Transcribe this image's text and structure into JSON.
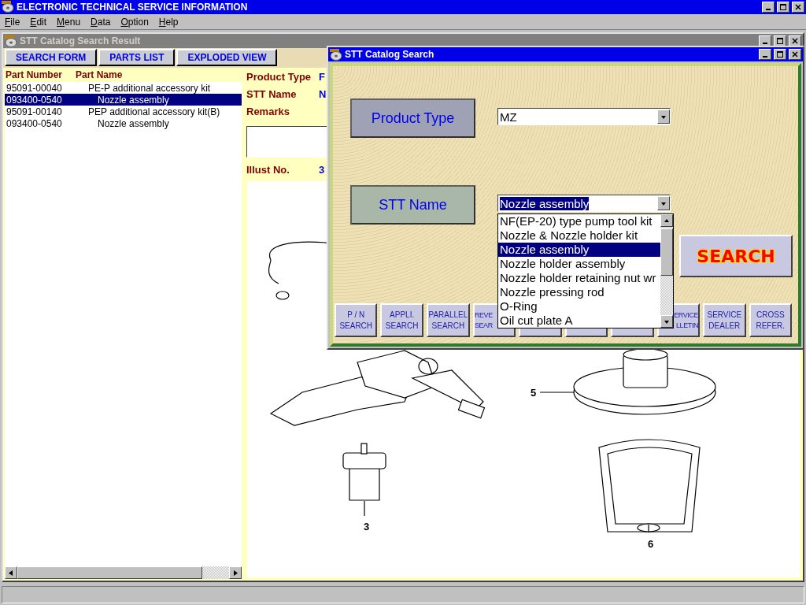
{
  "app": {
    "title": "ELECTRONIC TECHNICAL SERVICE INFORMATION"
  },
  "menu": [
    "File",
    "Edit",
    "Menu",
    "Data",
    "Option",
    "Help"
  ],
  "result_window": {
    "title": "STT Catalog Search Result",
    "toolbar": [
      "SEARCH FORM",
      "PARTS LIST",
      "EXPLODED VIEW"
    ],
    "columns": [
      "Part Number",
      "Part Name"
    ],
    "rows": [
      {
        "part_number": "95091-00040",
        "part_name": "PE-P additional accessory kit",
        "selected": false,
        "children": [
          {
            "part_number": "093400-0540",
            "part_name": "Nozzle assembly",
            "selected": true
          }
        ]
      },
      {
        "part_number": "95091-00140",
        "part_name": "PEP additional accessory kit(B)",
        "selected": false,
        "children": [
          {
            "part_number": "093400-0540",
            "part_name": "Nozzle assembly",
            "selected": false
          }
        ]
      }
    ],
    "info": [
      {
        "label": "Product Type",
        "value": "F"
      },
      {
        "label": "STT Name",
        "value": "N"
      },
      {
        "label": "Remarks"
      }
    ],
    "illust": {
      "label": "Illust No.",
      "value": "3"
    },
    "callouts": [
      "5",
      "3",
      "6"
    ]
  },
  "search_dialog": {
    "title": "STT Catalog Search",
    "fields": [
      {
        "label": "Product Type",
        "color": "#9ea2b4",
        "value": "MZ",
        "expanded": false
      },
      {
        "label": "STT Name",
        "color": "#a9b7a9",
        "value": "Nozzle assembly",
        "expanded": true,
        "options": [
          {
            "text": "NF(EP-20) type pump tool kit",
            "selected": false
          },
          {
            "text": "Nozzle & Nozzle holder kit",
            "selected": false
          },
          {
            "text": "Nozzle assembly",
            "selected": true
          },
          {
            "text": "Nozzle holder assembly",
            "selected": false
          },
          {
            "text": "Nozzle holder retaining nut wr",
            "selected": false
          },
          {
            "text": "Nozzle pressing rod",
            "selected": false
          },
          {
            "text": "O-Ring",
            "selected": false
          },
          {
            "text": "Oil cut plate A",
            "selected": false
          }
        ]
      }
    ],
    "search_button": "SEARCH",
    "buttons": [
      {
        "lines": [
          "P / N",
          "SEARCH"
        ]
      },
      {
        "lines": [
          "APPLI.",
          "SEARCH"
        ]
      },
      {
        "lines": [
          "PARALLEL",
          "SEARCH"
        ]
      },
      {
        "kind": "cut-right",
        "lines": [
          "REVE",
          "SEAR"
        ]
      },
      {
        "kind": "covered"
      },
      {
        "kind": "covered"
      },
      {
        "kind": "covered"
      },
      {
        "kind": "cut-left",
        "lines": [
          "ERVICE",
          "LLETIN"
        ]
      },
      {
        "lines": [
          "SERVICE",
          "DEALER"
        ]
      },
      {
        "lines": [
          "CROSS",
          "REFER."
        ]
      }
    ]
  }
}
